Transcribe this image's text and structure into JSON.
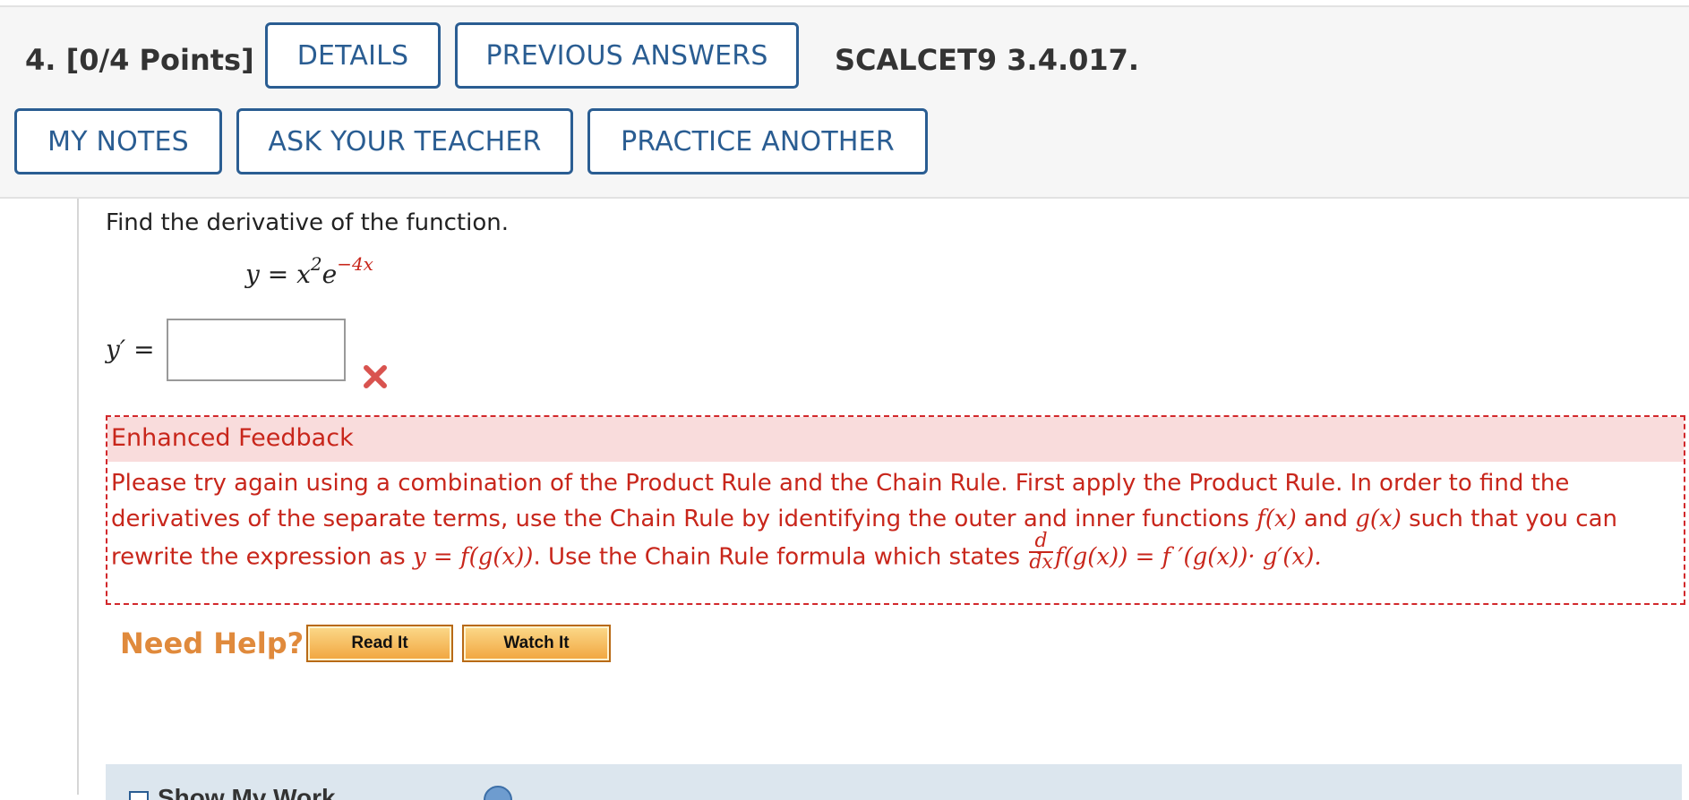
{
  "header": {
    "question_number": "4.",
    "points": "[0/4 Points]",
    "buttons": {
      "details": "DETAILS",
      "previous_answers": "PREVIOUS ANSWERS",
      "my_notes": "MY NOTES",
      "ask_teacher": "ASK YOUR TEACHER",
      "practice_another": "PRACTICE ANOTHER"
    },
    "assignment_id": "SCALCET9 3.4.017."
  },
  "question": {
    "prompt": "Find the derivative of the function.",
    "formula": {
      "lhs": "y = x",
      "sup1": "2",
      "mid": "e",
      "sup2": "−4x"
    },
    "answer_label": "y′ =",
    "answer_value": "",
    "answer_status": "incorrect",
    "status_icon": "x-mark-icon",
    "status_color": "#d9534f"
  },
  "feedback": {
    "title": "Enhanced Feedback",
    "text1": "Please try again using a combination of the Product Rule and the Chain Rule. First apply the Product Rule. In order to find the derivatives of the separate terms, use the Chain Rule by identifying the outer and inner functions ",
    "fx": "f(x)",
    "and": " and ",
    "gx": "g(x)",
    "text2": " such that you can rewrite the expression as ",
    "expr": "y = f(g(x))",
    "text3": ". Use the Chain Rule formula which states ",
    "frac_num": "d",
    "frac_den": "dx",
    "rule": "f(g(x)) = f ′(g(x))· g′(x).",
    "color": "#c8261b"
  },
  "help": {
    "label": "Need Help?",
    "read_it": "Read It",
    "watch_it": "Watch It"
  },
  "show_work": {
    "label": "Show My Work"
  }
}
